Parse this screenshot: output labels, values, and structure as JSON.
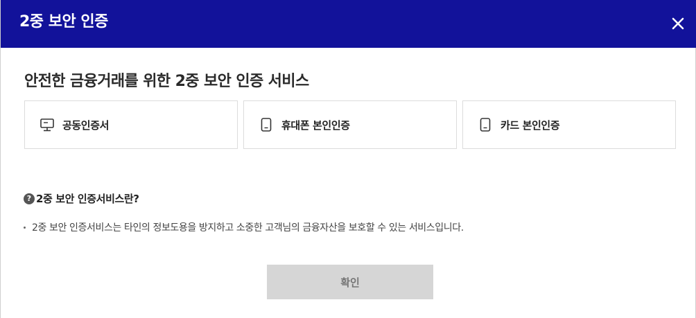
{
  "header": {
    "title": "2중 보안 인증",
    "close_icon": "close-icon",
    "background_color": "#12129a"
  },
  "main": {
    "section_title": "안전한 금융거래를 위한 2중 보안 인증 서비스",
    "options": [
      {
        "label": "공동인증서",
        "icon": "monitor-icon"
      },
      {
        "label": "휴대폰 본인인증",
        "icon": "phone-icon"
      },
      {
        "label": "카드 본인인증",
        "icon": "card-icon"
      }
    ],
    "info": {
      "title": "2중 보안 인증서비스란?",
      "description": "2중 보안 인증서비스는 타인의 정보도용을 방지하고 소중한 고객님의 금융자산을 보호할 수 있는 서비스입니다."
    },
    "confirm_label": "확인"
  }
}
